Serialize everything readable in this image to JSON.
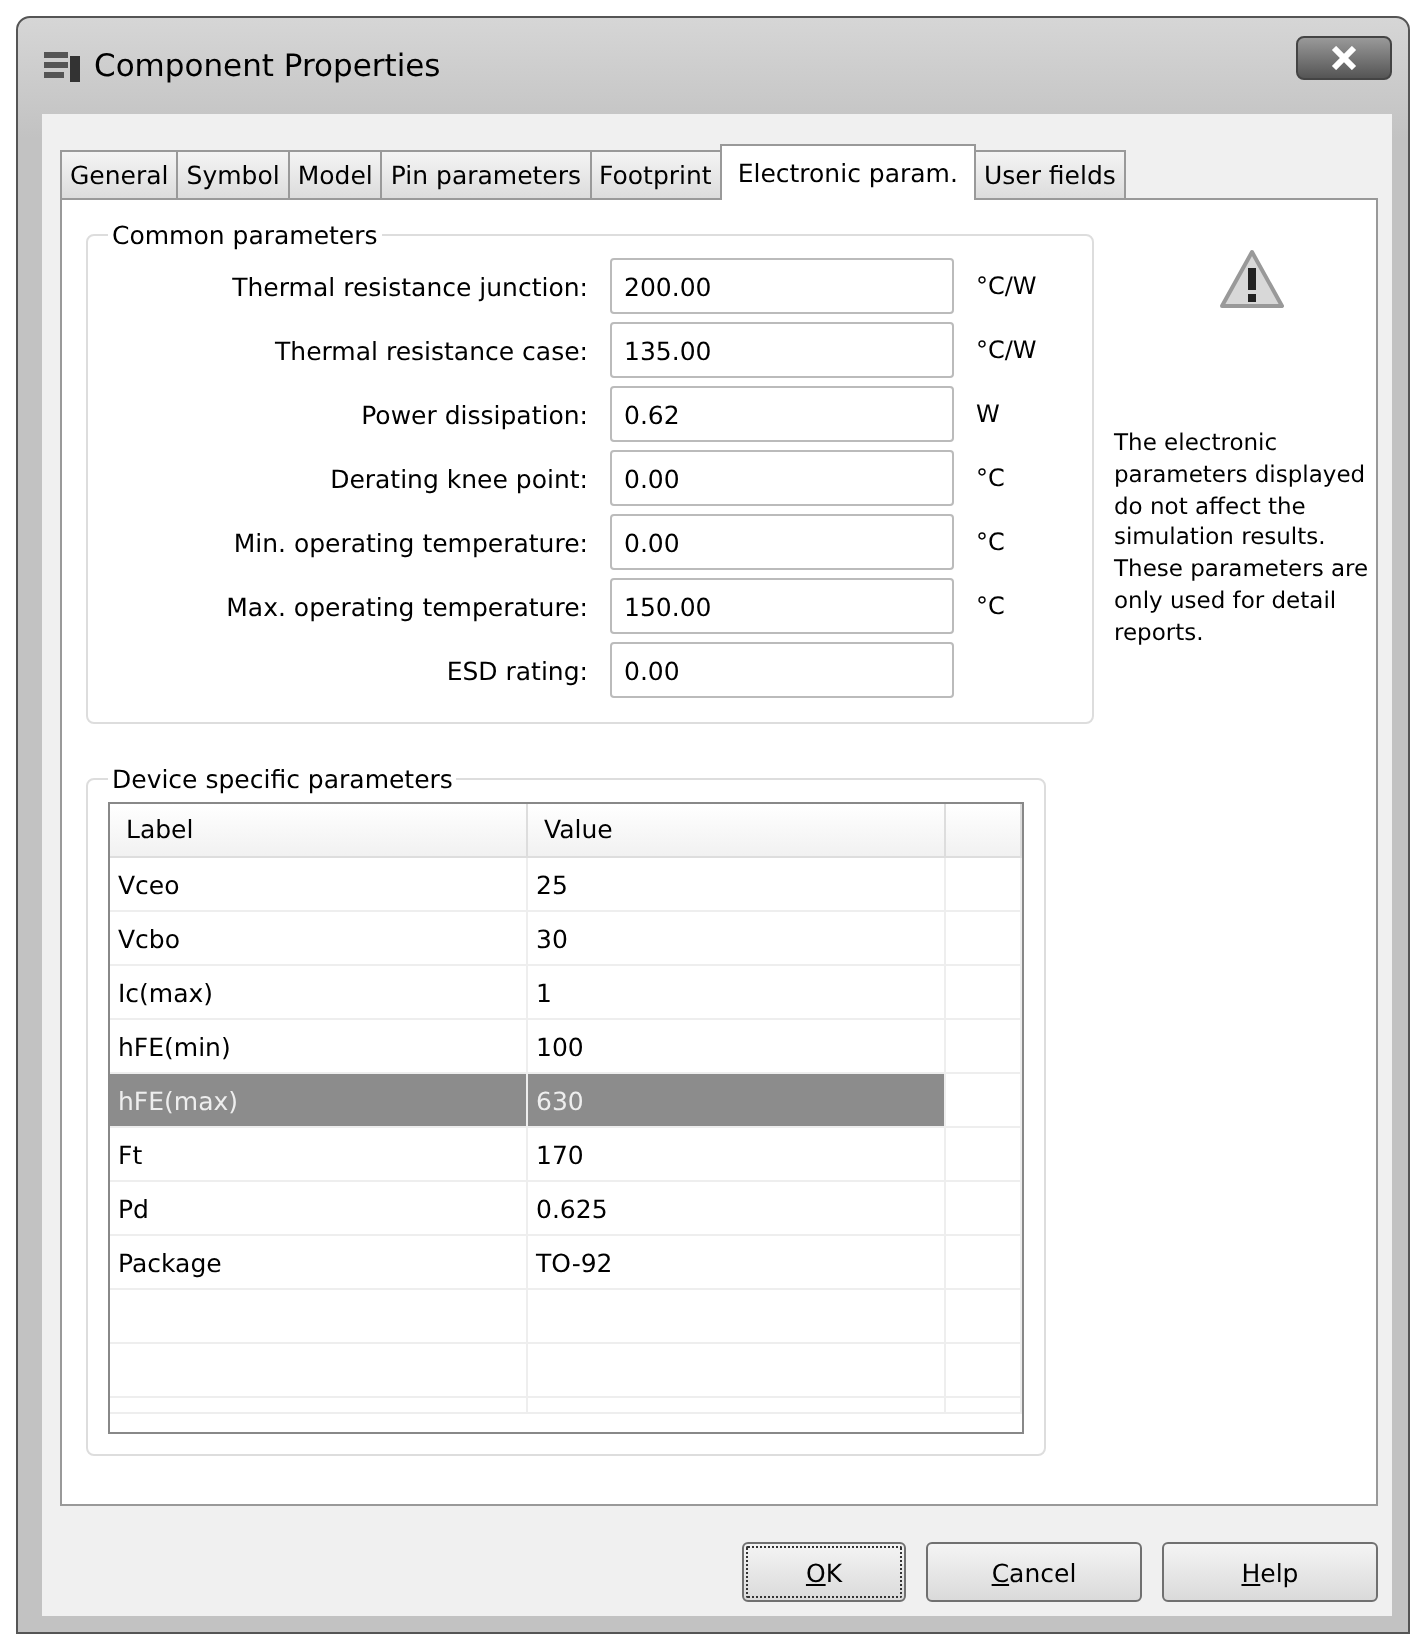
{
  "window": {
    "title": "Component Properties"
  },
  "tabs": [
    {
      "label": "General",
      "selected": false
    },
    {
      "label": "Symbol",
      "selected": false
    },
    {
      "label": "Model",
      "selected": false
    },
    {
      "label": "Pin parameters",
      "selected": false
    },
    {
      "label": "Footprint",
      "selected": false
    },
    {
      "label": "Electronic param.",
      "selected": true
    },
    {
      "label": "User fields",
      "selected": false
    }
  ],
  "common_parameters": {
    "title": "Common parameters",
    "fields": [
      {
        "label": "Thermal resistance junction:",
        "value": "200.00",
        "unit": "°C/W"
      },
      {
        "label": "Thermal resistance case:",
        "value": "135.00",
        "unit": "°C/W"
      },
      {
        "label": "Power dissipation:",
        "value": "0.62",
        "unit": "W"
      },
      {
        "label": "Derating knee point:",
        "value": "0.00",
        "unit": "°C"
      },
      {
        "label": "Min. operating temperature:",
        "value": "0.00",
        "unit": "°C"
      },
      {
        "label": "Max. operating temperature:",
        "value": "150.00",
        "unit": "°C"
      },
      {
        "label": "ESD rating:",
        "value": "0.00"
      }
    ]
  },
  "notice": "The electronic parameters displayed do not affect the simulation results. These parameters are only used for detail reports.",
  "device_parameters": {
    "title": "Device specific parameters",
    "columns": [
      "Label",
      "Value"
    ],
    "rows": [
      {
        "label": "Vceo",
        "value": "25",
        "selected": false
      },
      {
        "label": "Vcbo",
        "value": "30",
        "selected": false
      },
      {
        "label": "Ic(max)",
        "value": "1",
        "selected": false
      },
      {
        "label": "hFE(min)",
        "value": "100",
        "selected": false
      },
      {
        "label": "hFE(max)",
        "value": "630",
        "selected": true
      },
      {
        "label": "Ft",
        "value": "170",
        "selected": false
      },
      {
        "label": "Pd",
        "value": "0.625",
        "selected": false
      },
      {
        "label": "Package",
        "value": "TO-92",
        "selected": false
      }
    ]
  },
  "buttons": [
    {
      "accel": "O",
      "rest": "K",
      "focused": true
    },
    {
      "accel": "C",
      "rest": "ancel",
      "focused": false
    },
    {
      "accel": "H",
      "rest": "elp",
      "focused": false
    }
  ]
}
